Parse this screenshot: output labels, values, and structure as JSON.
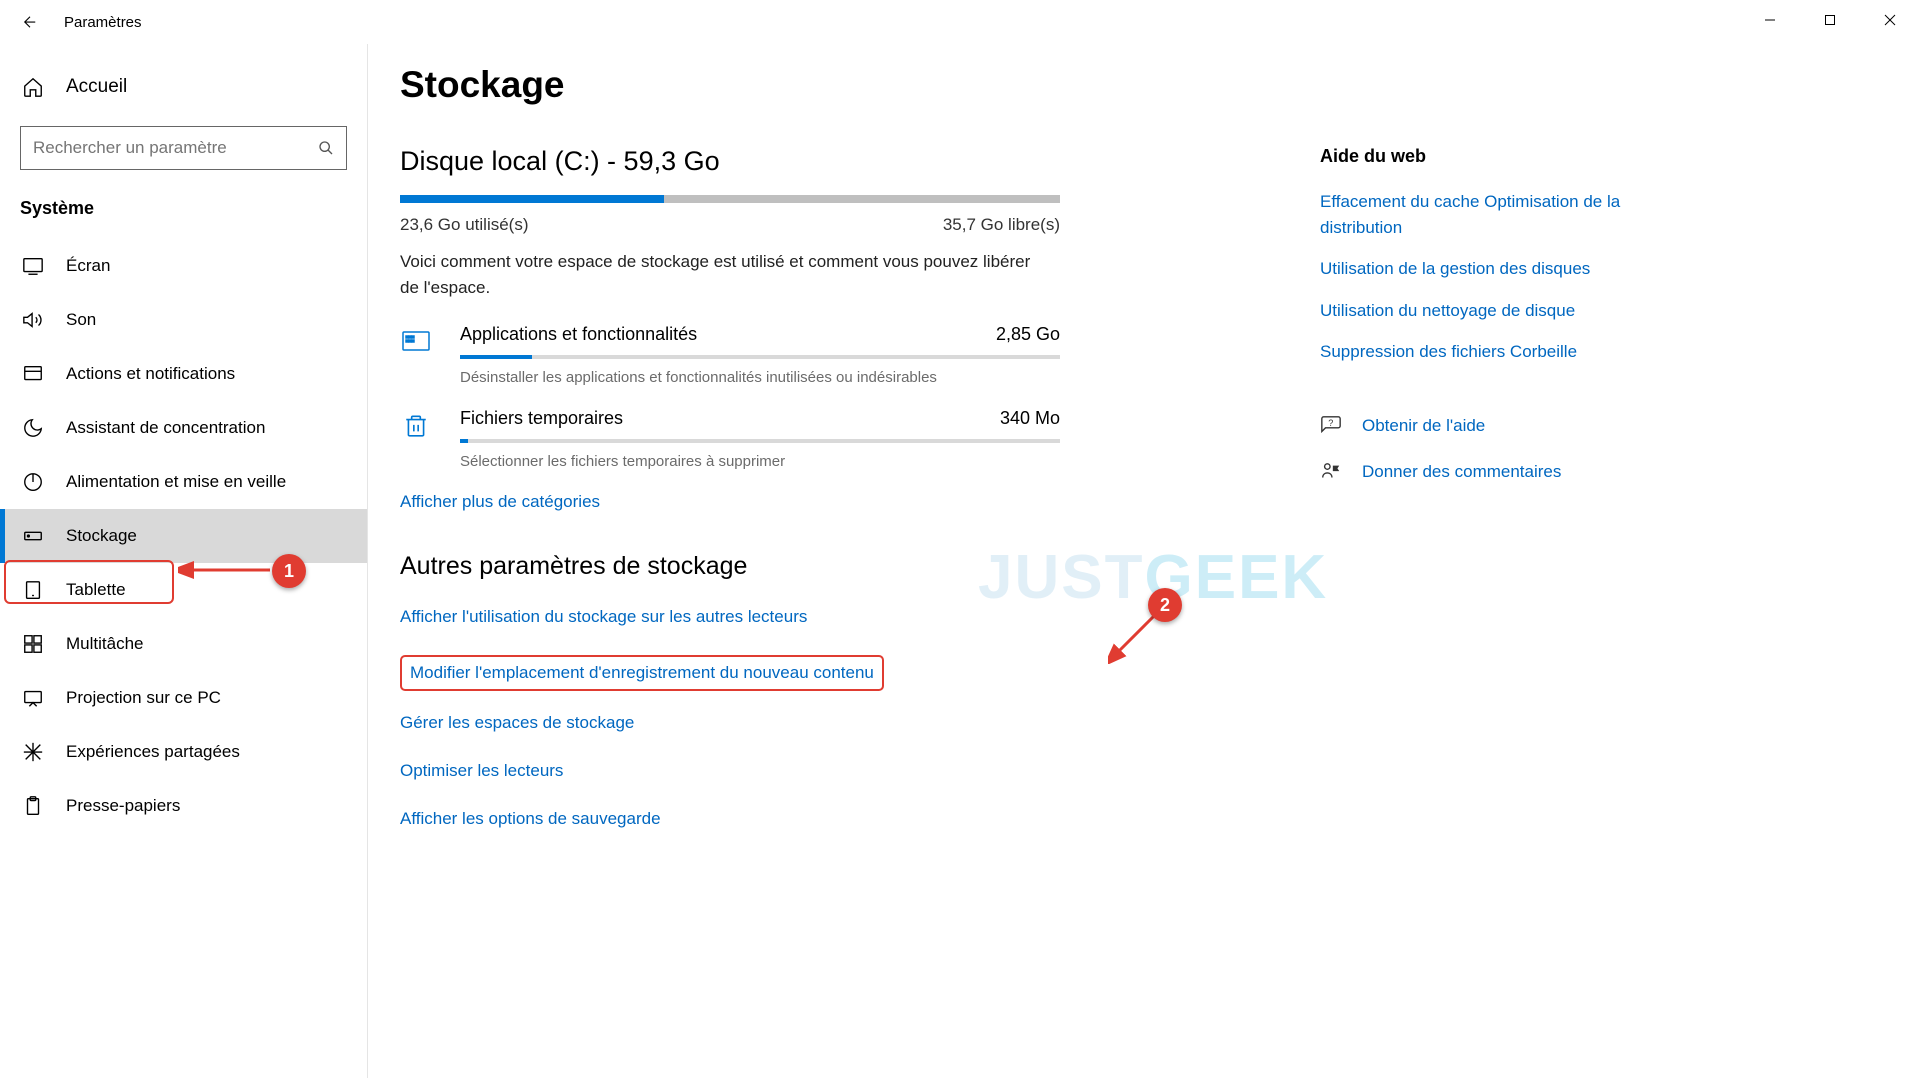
{
  "titlebar": {
    "title": "Paramètres"
  },
  "sidebar": {
    "home": "Accueil",
    "search_placeholder": "Rechercher un paramètre",
    "section": "Système",
    "items": [
      {
        "label": "Écran"
      },
      {
        "label": "Son"
      },
      {
        "label": "Actions et notifications"
      },
      {
        "label": "Assistant de concentration"
      },
      {
        "label": "Alimentation et mise en veille"
      },
      {
        "label": "Stockage"
      },
      {
        "label": "Tablette"
      },
      {
        "label": "Multitâche"
      },
      {
        "label": "Projection sur ce PC"
      },
      {
        "label": "Expériences partagées"
      },
      {
        "label": "Presse-papiers"
      }
    ]
  },
  "main": {
    "title": "Stockage",
    "disk_title": "Disque local (C:) - 59,3 Go",
    "used_label": "23,6 Go utilisé(s)",
    "free_label": "35,7 Go libre(s)",
    "desc": "Voici comment votre espace de stockage est utilisé et comment vous pouvez libérer de l'espace.",
    "cats": [
      {
        "name": "Applications et fonctionnalités",
        "size": "2,85 Go",
        "desc": "Désinstaller les applications et fonctionnalités inutilisées ou indésirables",
        "pct": 12
      },
      {
        "name": "Fichiers temporaires",
        "size": "340 Mo",
        "desc": "Sélectionner les fichiers temporaires à supprimer",
        "pct": 1.4
      }
    ],
    "more_cats": "Afficher plus de catégories",
    "other_title": "Autres paramètres de stockage",
    "other_links": [
      "Afficher l'utilisation du stockage sur les autres lecteurs",
      "Modifier l'emplacement d'enregistrement du nouveau contenu",
      "Gérer les espaces de stockage",
      "Optimiser les lecteurs",
      "Afficher les options de sauvegarde"
    ]
  },
  "help": {
    "title": "Aide du web",
    "links": [
      "Effacement du cache Optimisation de la distribution",
      "Utilisation de la gestion des disques",
      "Utilisation du nettoyage de disque",
      "Suppression des fichiers Corbeille"
    ],
    "get_help": "Obtenir de l'aide",
    "feedback": "Donner des commentaires"
  },
  "annotations": {
    "badge1": "1",
    "badge2": "2"
  },
  "watermark": "JUSTGEEK"
}
